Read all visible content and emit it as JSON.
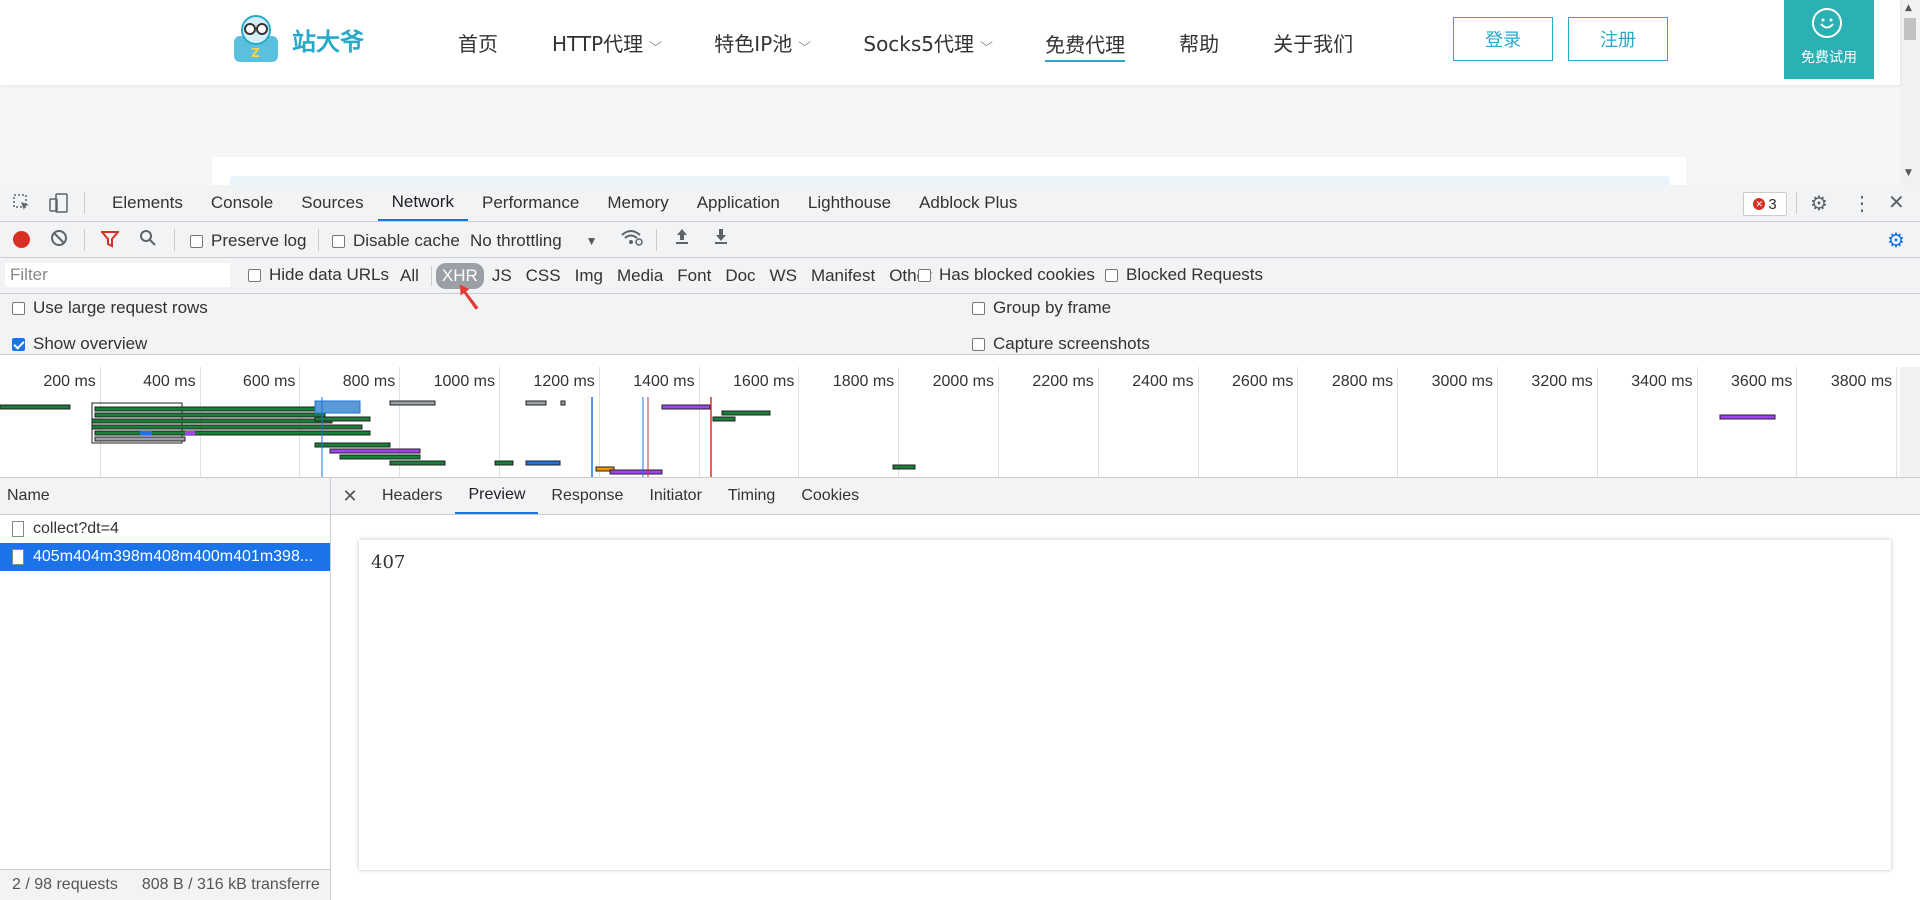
{
  "site": {
    "logo_text": "站大爷",
    "nav": [
      {
        "label": "首页",
        "dropdown": false
      },
      {
        "label": "HTTP代理",
        "dropdown": true
      },
      {
        "label": "特色IP池",
        "dropdown": true
      },
      {
        "label": "Socks5代理",
        "dropdown": true
      },
      {
        "label": "免费代理",
        "dropdown": false,
        "active": true
      },
      {
        "label": "帮助",
        "dropdown": false
      },
      {
        "label": "关于我们",
        "dropdown": false
      }
    ],
    "login_label": "登录",
    "register_label": "注册",
    "trial_label": "免费试用",
    "brand_color": "#27a9c9"
  },
  "devtools": {
    "tabs": [
      "Elements",
      "Console",
      "Sources",
      "Network",
      "Performance",
      "Memory",
      "Application",
      "Lighthouse",
      "Adblock Plus"
    ],
    "active_tab": "Network",
    "error_count": "3",
    "toolbar": {
      "preserve_log": "Preserve log",
      "disable_cache": "Disable cache",
      "throttling": "No throttling"
    },
    "filter": {
      "placeholder": "Filter",
      "hide_data_urls": "Hide data URLs",
      "types": [
        "All",
        "XHR",
        "JS",
        "CSS",
        "Img",
        "Media",
        "Font",
        "Doc",
        "WS",
        "Manifest",
        "Other"
      ],
      "active_type": "XHR",
      "has_blocked_cookies": "Has blocked cookies",
      "blocked_requests": "Blocked Requests"
    },
    "options": {
      "large_rows": "Use large request rows",
      "show_overview": "Show overview",
      "group_by_frame": "Group by frame",
      "capture_screenshots": "Capture screenshots"
    },
    "overview_ticks": [
      "200 ms",
      "400 ms",
      "600 ms",
      "800 ms",
      "1000 ms",
      "1200 ms",
      "1400 ms",
      "1600 ms",
      "1800 ms",
      "2000 ms",
      "2200 ms",
      "2400 ms",
      "2600 ms",
      "2800 ms",
      "3000 ms",
      "3200 ms",
      "3400 ms",
      "3600 ms",
      "3800 ms"
    ],
    "requests_header": "Name",
    "requests": [
      {
        "name": "collect?dt=4",
        "selected": false
      },
      {
        "name": "405m404m398m408m400m401m398...",
        "selected": true
      }
    ],
    "status": {
      "requests": "2 / 98 requests",
      "transferred": "808 B / 316 kB transferre"
    },
    "detail_tabs": [
      "Headers",
      "Preview",
      "Response",
      "Initiator",
      "Timing",
      "Cookies"
    ],
    "active_detail_tab": "Preview",
    "preview_content": "407"
  }
}
